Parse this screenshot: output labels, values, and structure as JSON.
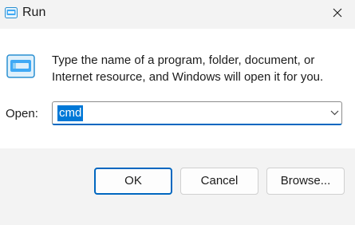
{
  "window": {
    "title": "Run",
    "close_icon": "close-icon",
    "app_icon": "run-icon"
  },
  "body": {
    "description": "Type the name of a program, folder, document, or Internet resource, and Windows will open it for you.",
    "open_label": "Open:",
    "open_value": "cmd"
  },
  "buttons": {
    "ok": "OK",
    "cancel": "Cancel",
    "browse": "Browse..."
  },
  "colors": {
    "accent": "#0067c0",
    "selection": "#0078d7"
  }
}
